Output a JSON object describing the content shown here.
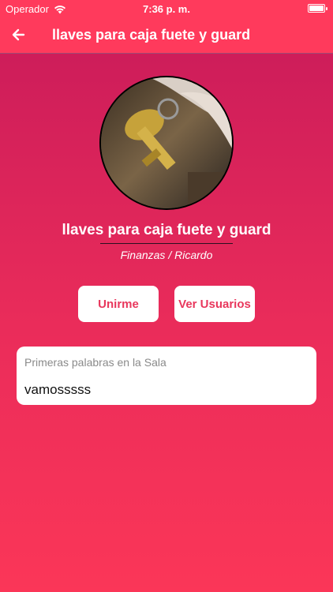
{
  "status_bar": {
    "carrier": "Operador",
    "time": "7:36 p. m.",
    "battery_level": 1.0,
    "icons": [
      "wifi-icon",
      "battery-icon"
    ]
  },
  "nav": {
    "back_icon": "arrow-left-icon",
    "title": "llaves para caja fuete y guard"
  },
  "room": {
    "image_icon": "keys-photo",
    "title": "llaves para caja fuete y guard",
    "category": "Finanzas",
    "separator": "/",
    "owner": "Ricardo"
  },
  "actions": {
    "join_label": "Unirme",
    "users_label": "Ver Usuarios"
  },
  "message": {
    "label": "Primeras palabras en la Sala",
    "text": "vamosssss"
  },
  "colors": {
    "bar": "#ff3a5c",
    "accent": "#e8375c",
    "gradient_top": "#c81a5a",
    "gradient_bottom": "#fb3658"
  }
}
